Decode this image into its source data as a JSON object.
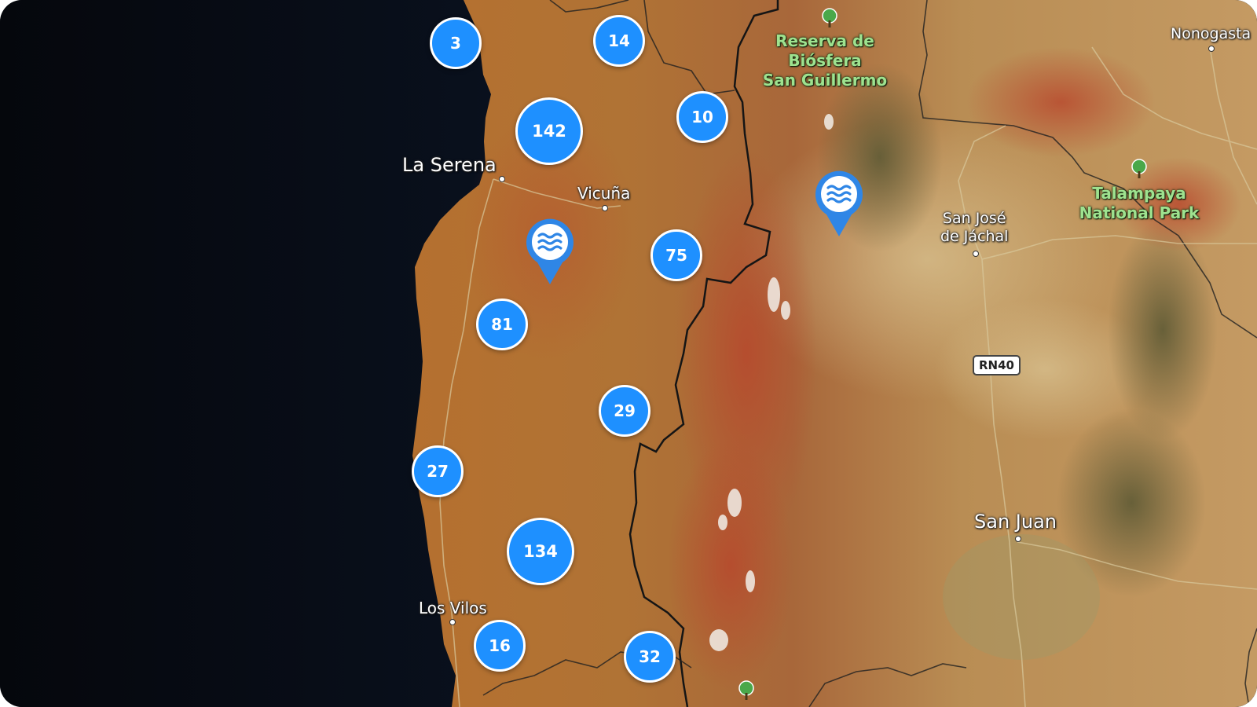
{
  "map": {
    "clusters": [
      {
        "count": "3"
      },
      {
        "count": "14"
      },
      {
        "count": "142"
      },
      {
        "count": "10"
      },
      {
        "count": "75"
      },
      {
        "count": "81"
      },
      {
        "count": "29"
      },
      {
        "count": "27"
      },
      {
        "count": "134"
      },
      {
        "count": "16"
      },
      {
        "count": "32"
      }
    ],
    "places": {
      "la_serena": "La Serena",
      "vicuna": "Vicuña",
      "los_vilos": "Los Vilos",
      "san_jose_line1": "San José",
      "san_jose_line2": "de Jáchal",
      "san_juan": "San Juan",
      "nonogasta": "Nonogasta"
    },
    "parks": {
      "san_guillermo_line1": "Reserva de Biósfera",
      "san_guillermo_line2": "San Guillermo",
      "talampaya_line1": "Talampaya",
      "talampaya_line2": "National Park"
    },
    "road_shield": "RN40",
    "water_pins": [
      {
        "icon": "water-waves-icon"
      },
      {
        "icon": "water-waves-icon"
      }
    ],
    "park_icon": "tree-icon",
    "colors": {
      "cluster": "#1e90ff",
      "pin": "#2f86e6",
      "park_label": "#9ee28f",
      "ocean": "#0a0f18"
    }
  }
}
